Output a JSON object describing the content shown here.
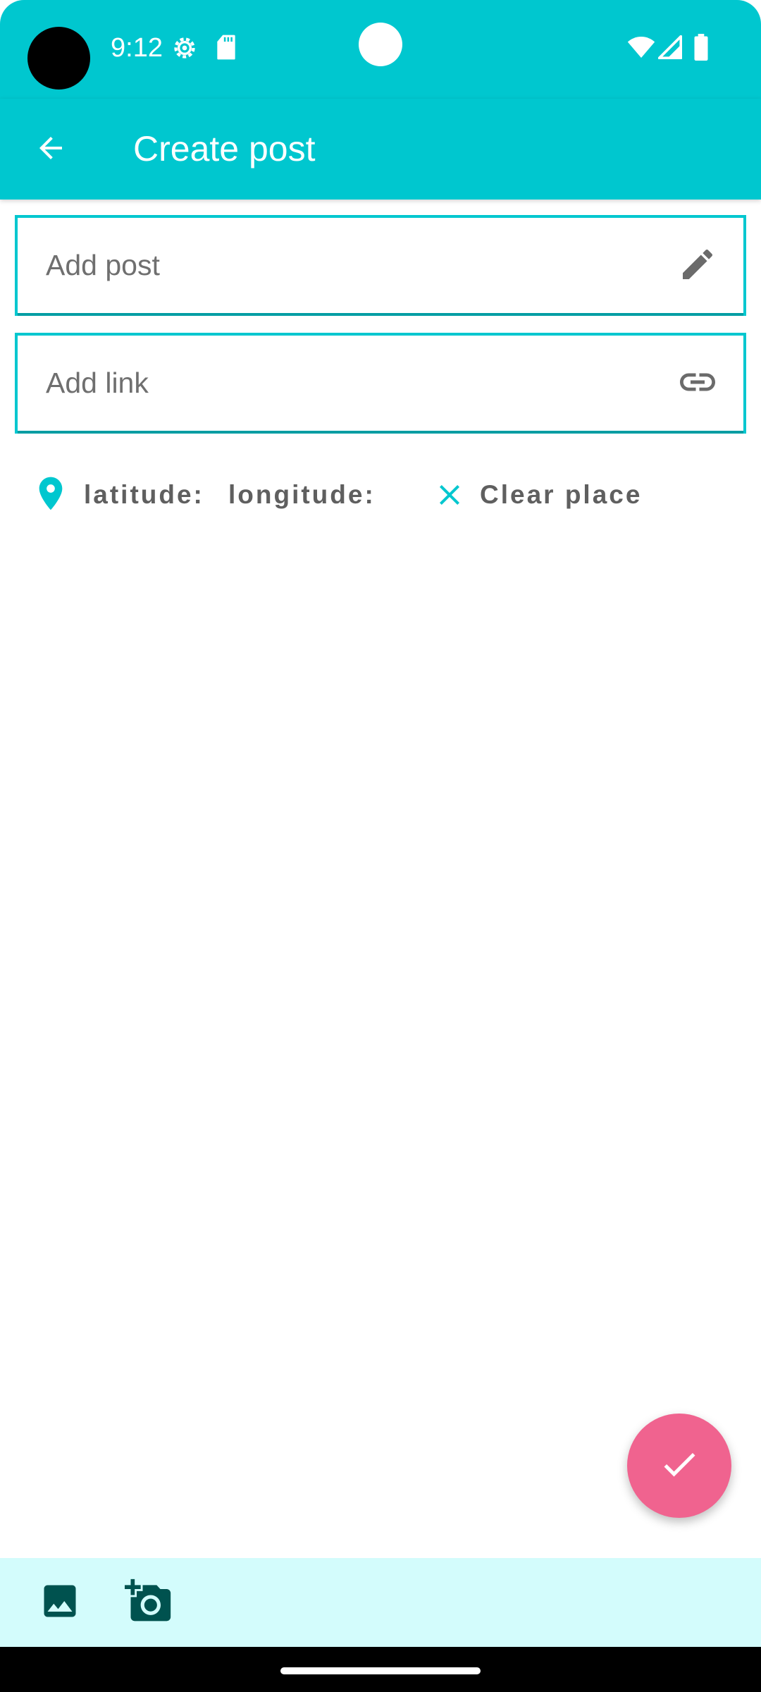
{
  "status_bar": {
    "time": "9:12",
    "icons": [
      "settings-gear-icon",
      "sd-card-icon",
      "wifi-icon",
      "cell-signal-icon",
      "battery-icon"
    ]
  },
  "app_bar": {
    "title": "Create post",
    "back_icon": "arrow-back-icon"
  },
  "post_field": {
    "placeholder": "Add post",
    "value": "",
    "icon": "edit-pencil-icon"
  },
  "link_field": {
    "placeholder": "Add link",
    "value": "",
    "icon": "link-icon"
  },
  "location": {
    "pin_icon": "location-pin-icon",
    "latitude_label": "latitude:",
    "latitude_value": "",
    "longitude_label": "longitude:",
    "longitude_value": "",
    "clear_label": "Clear place",
    "clear_icon": "close-icon"
  },
  "fab": {
    "icon": "check-icon"
  },
  "bottom_bar": {
    "gallery_icon": "image-gallery-icon",
    "camera_icon": "add-camera-icon"
  },
  "colors": {
    "primary": "#00c7cf",
    "accent": "#f0638f",
    "toolbar_bg": "#d3fcfc",
    "icon_dark": "#00524f",
    "text_secondary": "#5f5f5f"
  }
}
